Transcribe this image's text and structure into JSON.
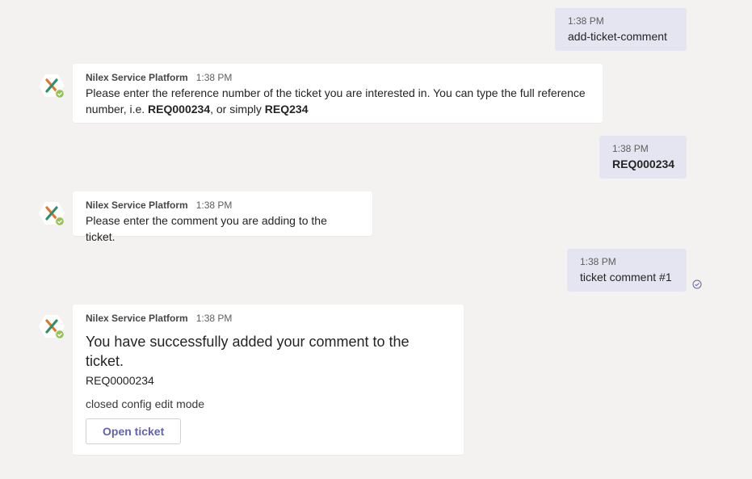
{
  "bot": {
    "name": "Nilex Service Platform"
  },
  "messages": {
    "m1": {
      "time": "1:38 PM",
      "text": "add-ticket-comment"
    },
    "m2": {
      "time": "1:38 PM",
      "line1": "Please enter the reference number of the ticket you are interested in. You can type the full reference",
      "line2_pre": "number, i.e. ",
      "bold1": "REQ000234",
      "mid": ", or simply ",
      "bold2": "REQ234"
    },
    "m3": {
      "time": "1:38 PM",
      "text": "REQ000234"
    },
    "m4": {
      "time": "1:38 PM",
      "text": "Please enter the comment you are adding to the ticket."
    },
    "m5": {
      "time": "1:38 PM",
      "text": "ticket comment #1"
    },
    "m6": {
      "time": "1:38 PM",
      "title": "You have successfully added your comment to the ticket.",
      "ref": "REQ0000234",
      "note": "closed config edit mode",
      "button": "Open ticket"
    }
  },
  "colors": {
    "outgoing_bubble": "#e5e5f1",
    "accent": "#6264a7",
    "status_green": "#92c353"
  }
}
